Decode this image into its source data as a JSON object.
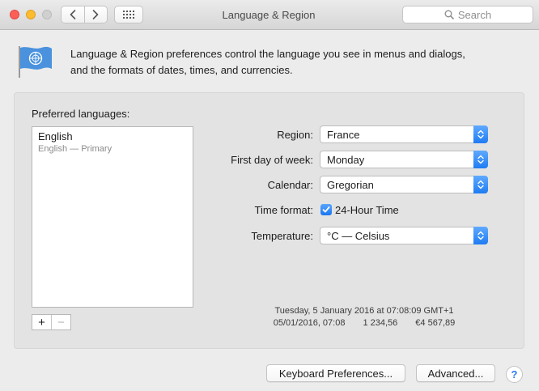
{
  "window": {
    "title": "Language & Region"
  },
  "search": {
    "placeholder": "Search"
  },
  "header": {
    "description_line1": "Language & Region preferences control the language you see in menus and dialogs,",
    "description_line2": "and the formats of dates, times, and currencies."
  },
  "languages": {
    "label": "Preferred languages:",
    "items": [
      {
        "name": "English",
        "detail": "English — Primary"
      }
    ],
    "add_label": "+",
    "remove_label": "−"
  },
  "settings": {
    "region": {
      "label": "Region:",
      "value": "France"
    },
    "first_day": {
      "label": "First day of week:",
      "value": "Monday"
    },
    "calendar": {
      "label": "Calendar:",
      "value": "Gregorian"
    },
    "time_format": {
      "label": "Time format:",
      "checkbox_label": "24-Hour Time",
      "checked": true
    },
    "temperature": {
      "label": "Temperature:",
      "value": "°C — Celsius"
    }
  },
  "preview": {
    "line1": "Tuesday, 5 January 2016 at 07:08:09 GMT+1",
    "date_short": "05/01/2016, 07:08",
    "number": "1 234,56",
    "currency": "€4 567,89"
  },
  "buttons": {
    "keyboard": "Keyboard Preferences...",
    "advanced": "Advanced...",
    "help": "?"
  },
  "colors": {
    "accent": "#1f7cf2",
    "close": "#fc5f57",
    "minimize": "#fdbc2e",
    "zoom_disabled": "#d0d0d0"
  },
  "icons": [
    "back-chevron-icon",
    "forward-chevron-icon",
    "grid-icon",
    "search-icon",
    "un-flag-icon",
    "updown-arrows-icon",
    "checkmark-icon",
    "help-icon"
  ]
}
